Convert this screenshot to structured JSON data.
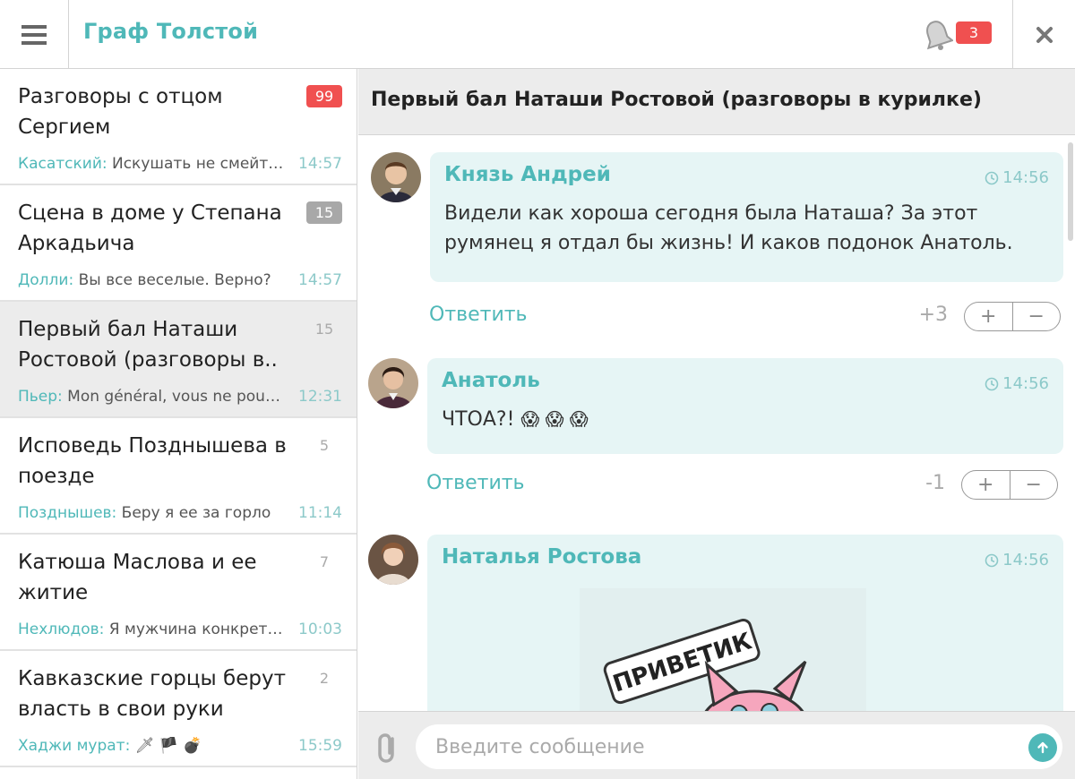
{
  "header": {
    "title": "Граф Толстой",
    "notifications_count": "3"
  },
  "sidebar": {
    "items": [
      {
        "name": "Разговоры с отцом Сергием",
        "count": "99",
        "count_style": "red",
        "author": "Касатский:",
        "preview": " Искушать не смейтесь",
        "time": "14:57"
      },
      {
        "name": "Сцена в доме у Степана Аркадьича",
        "count": "15",
        "count_style": "gray",
        "author": "Долли:",
        "preview": " Вы все веселые. Верно?",
        "time": "14:57"
      },
      {
        "name": "Первый бал Наташи Ростовой (разговоры в..",
        "count": "15",
        "count_style": "plain",
        "author": "Пьер:",
        "preview": " Mon général, vous ne pouvez",
        "time": "12:31"
      },
      {
        "name": "Исповедь Позднышева в поезде",
        "count": "5",
        "count_style": "plain",
        "author": "Позднышев:",
        "preview": " Беру я ее за горло",
        "time": "11:14"
      },
      {
        "name": "Катюша Маслова и ее житие",
        "count": "7",
        "count_style": "plain",
        "author": "Нехлюдов:",
        "preview": " Я мужчина конкретный",
        "time": "10:03"
      },
      {
        "name": "Кавказские горцы берут власть в свои руки",
        "count": "2",
        "count_style": "plain",
        "author": "Хаджи мурат:",
        "preview": " 🗡 🏴 💣",
        "time": "15:59"
      }
    ]
  },
  "conversation": {
    "title": "Первый бал Наташи Ростовой (разговоры в курилке)",
    "messages": [
      {
        "author": "Князь Андрей",
        "time": "14:56",
        "text_line1": "Видели как хороша сегодня была Наташа? За этот",
        "text_line2": "румянец я отдал бы жизнь! И каков подонок Анатоль.",
        "reply": "Ответить",
        "score": "+3"
      },
      {
        "author": "Анатоль",
        "time": "14:56",
        "text": "ЧТОА?!",
        "emojis": "😱 😱 😱",
        "reply": "Ответить",
        "score": "-1"
      },
      {
        "author": "Наталья Ростова",
        "time": "14:56",
        "sticker_text": "ПРИВЕТИК"
      }
    ],
    "vote_plus": "+",
    "vote_minus": "−"
  },
  "composer": {
    "placeholder": "Введите сообщение"
  },
  "colors": {
    "accent": "#4fb8b8",
    "badge_red": "#f05050",
    "bubble": "#e6f5f5"
  }
}
